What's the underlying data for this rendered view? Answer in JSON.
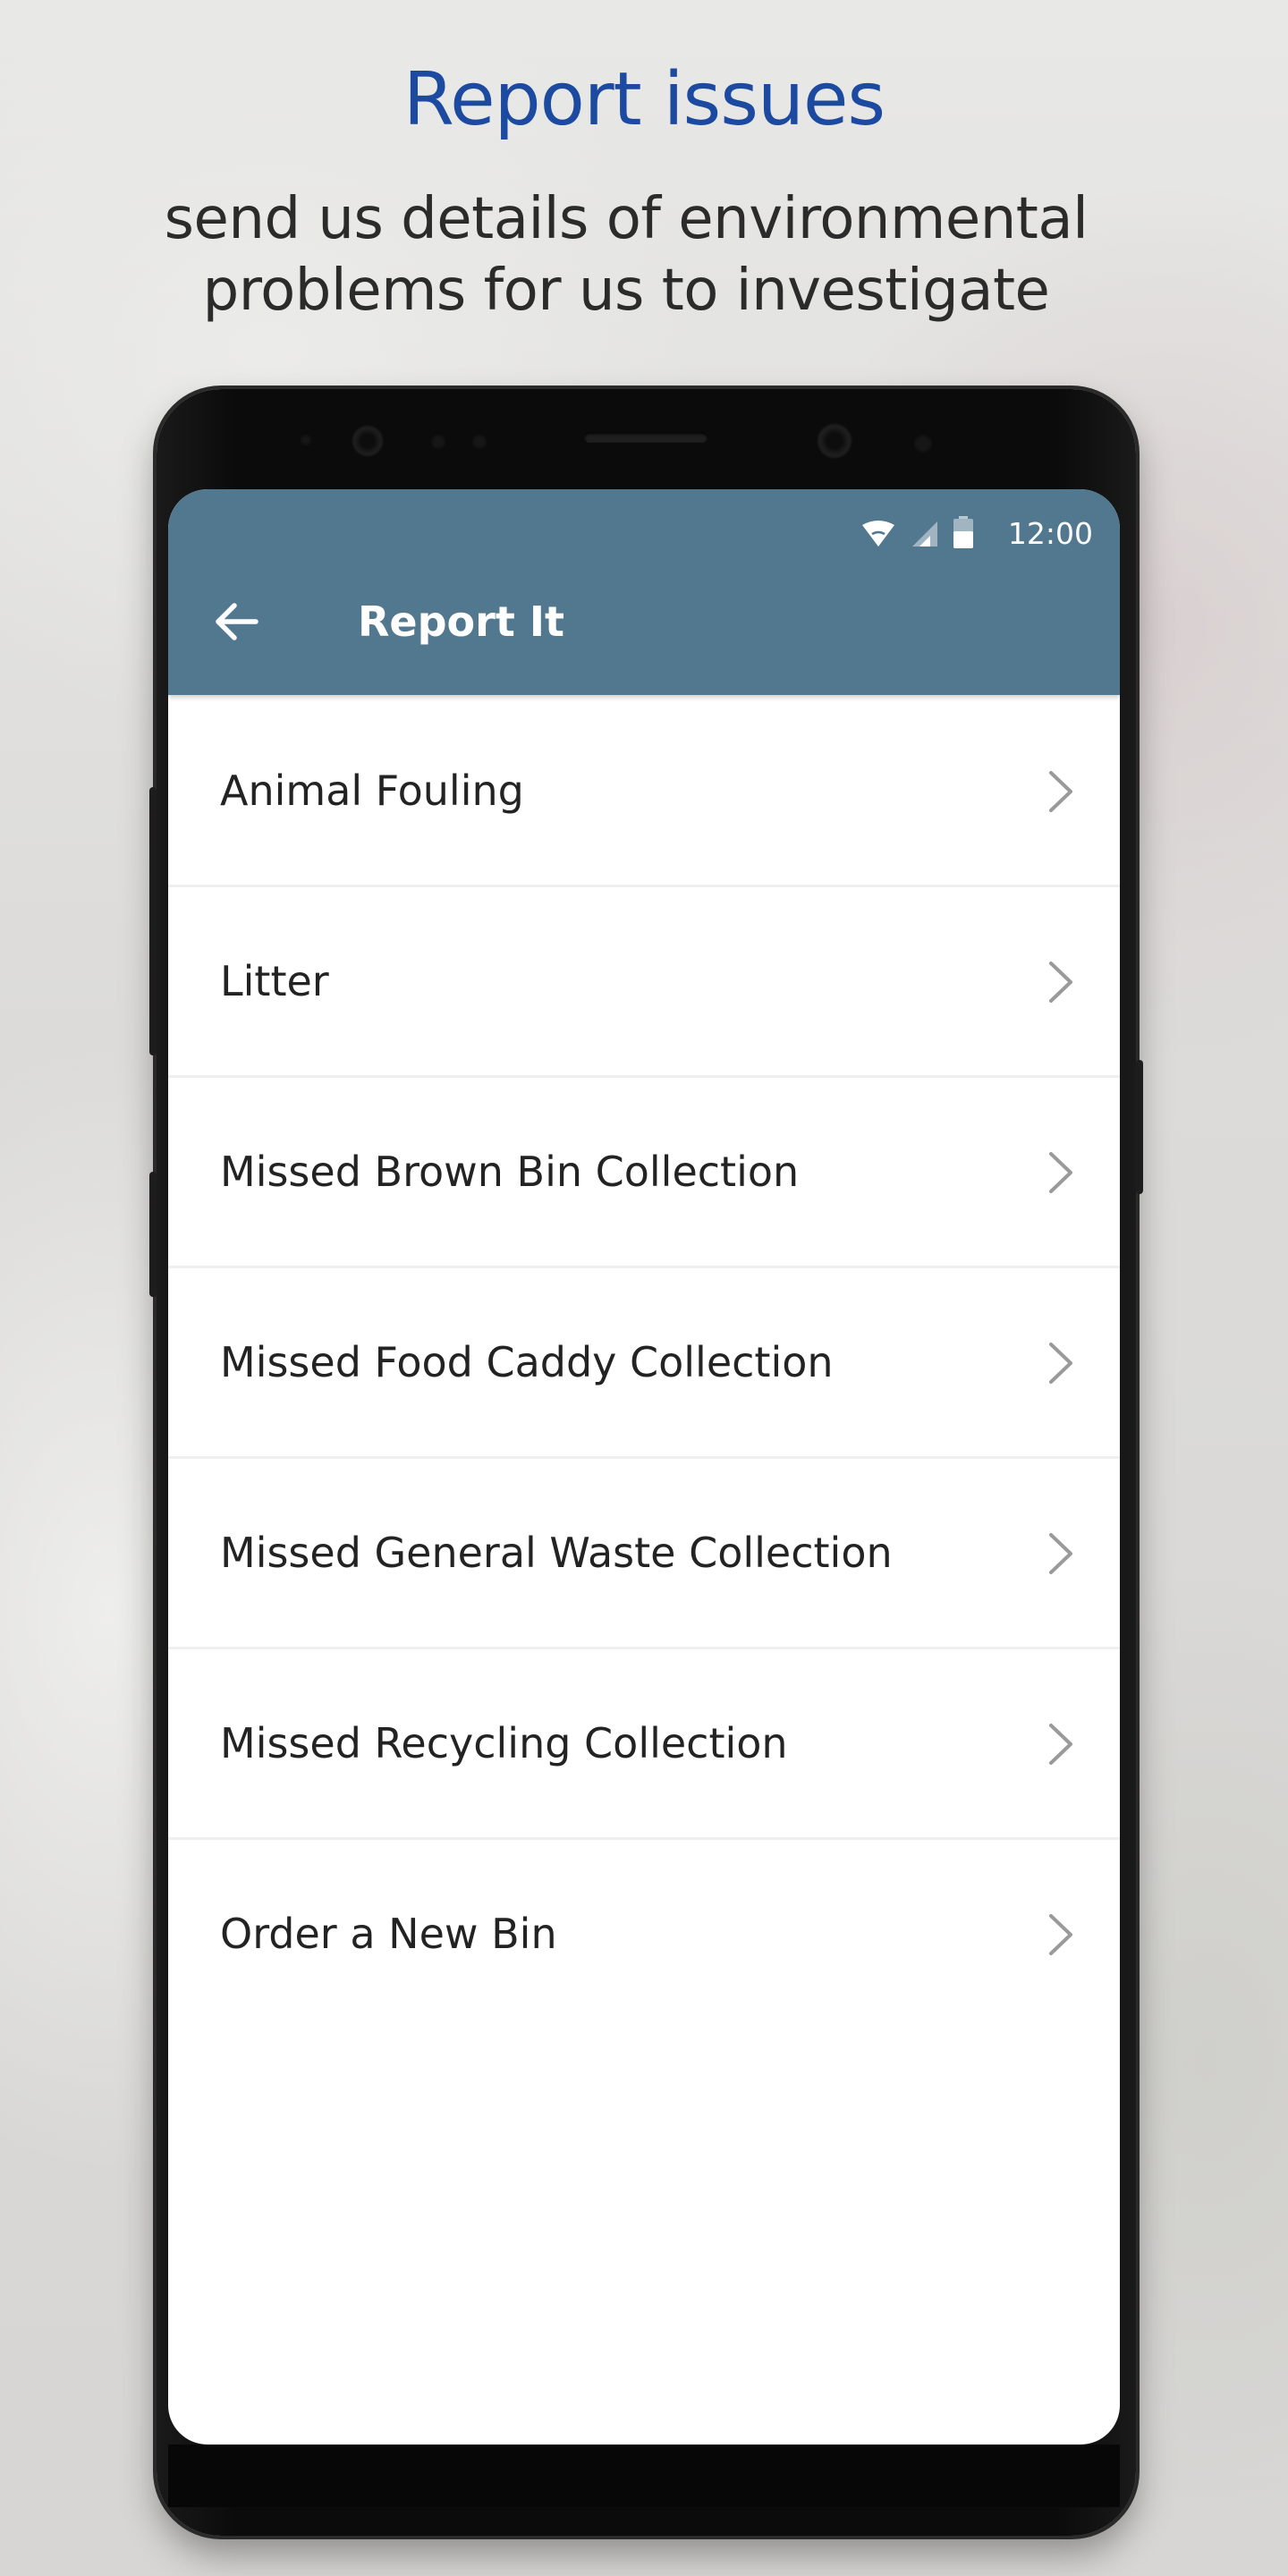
{
  "promo": {
    "title": "Report issues",
    "subtitle": "send us details of environmental problems for us to investigate"
  },
  "status_bar": {
    "time": "12:00",
    "icons": [
      "wifi-icon",
      "signal-icon",
      "battery-icon"
    ]
  },
  "appbar": {
    "title": "Report It",
    "back_icon": "arrow-left-icon",
    "color": "#52788f"
  },
  "list": {
    "items": [
      {
        "label": "Animal Fouling"
      },
      {
        "label": "Litter"
      },
      {
        "label": "Missed Brown Bin Collection"
      },
      {
        "label": "Missed Food Caddy Collection"
      },
      {
        "label": "Missed General Waste Collection"
      },
      {
        "label": "Missed Recycling Collection"
      },
      {
        "label": "Order a New Bin"
      }
    ],
    "item_icon": "chevron-right-icon"
  },
  "colors": {
    "promo_title": "#1b4aa0",
    "appbar": "#52788f",
    "text": "#232323"
  }
}
